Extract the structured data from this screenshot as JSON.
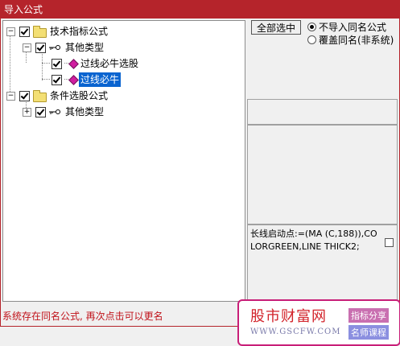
{
  "window": {
    "title": "导入公式"
  },
  "tree": {
    "nodes": [
      {
        "label": "技术指标公式",
        "expander": "−"
      },
      {
        "label": "其他类型",
        "expander": "−"
      },
      {
        "label": "过线必牛选股"
      },
      {
        "label": "过线必牛",
        "selected": true
      },
      {
        "label": "条件选股公式",
        "expander": "−"
      },
      {
        "label": "其他类型",
        "expander": "+"
      }
    ]
  },
  "actions": {
    "select_all_label": "全部选中"
  },
  "options": {
    "skip_same_name": "不导入同名公式",
    "overwrite_same_name": "覆盖同名(非系统)",
    "selected": "skip_same_name"
  },
  "formula_preview": {
    "text": "长线启动点:=(MA (C,188)),COLORGREEN,LINE THICK2;"
  },
  "status": {
    "message": "系统存在同名公式, 再次点击可以更名",
    "color": "#c0121a"
  },
  "watermark": {
    "brand": "股市财富网",
    "url": "WWW.GSCFW.COM",
    "tag1": "指标分享",
    "tag2": "名师课程"
  },
  "colors": {
    "titlebar": "#b5242b",
    "selection": "#0a64d0",
    "accent_magenta": "#c81e78"
  }
}
